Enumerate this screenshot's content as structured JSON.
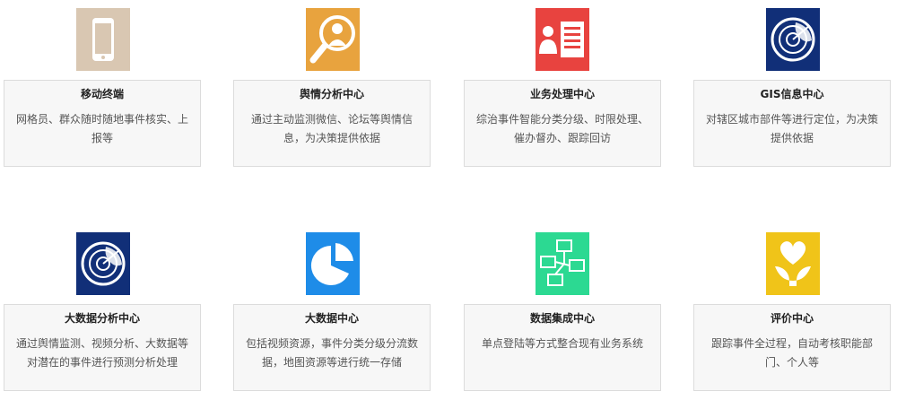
{
  "cards": [
    {
      "title": "移动终端",
      "description": "网格员、群众随时随地事件核实、上报等",
      "icon": "mobile-phone-icon",
      "color": "#d9c7b2"
    },
    {
      "title": "舆情分析中心",
      "description": "通过主动监测微信、论坛等舆情信息，为决策提供依据",
      "icon": "magnifier-person-icon",
      "color": "#e8a33e"
    },
    {
      "title": "业务处理中心",
      "description": "综治事件智能分类分级、时限处理、催办督办、跟踪回访",
      "icon": "person-document-icon",
      "color": "#e8433f"
    },
    {
      "title": "GIS信息中心",
      "description": "对辖区城市部件等进行定位，为决策提供依据",
      "icon": "radar-globe-icon",
      "color": "#112f78"
    },
    {
      "title": "大数据分析中心",
      "description": "通过舆情监测、视频分析、大数据等对潜在的事件进行预测分析处理",
      "icon": "radar-globe-icon",
      "color": "#112f78"
    },
    {
      "title": "大数据中心",
      "description": "包括视频资源，事件分类分级分流数据，地图资源等进行统一存储",
      "icon": "pie-chart-icon",
      "color": "#1e8ce8"
    },
    {
      "title": "数据集成中心",
      "description": "单点登陆等方式整合现有业务系统",
      "icon": "network-computers-icon",
      "color": "#2cd992"
    },
    {
      "title": "评价中心",
      "description": "跟踪事件全过程，自动考核职能部门、个人等",
      "icon": "heart-flower-icon",
      "color": "#f0c419"
    }
  ]
}
